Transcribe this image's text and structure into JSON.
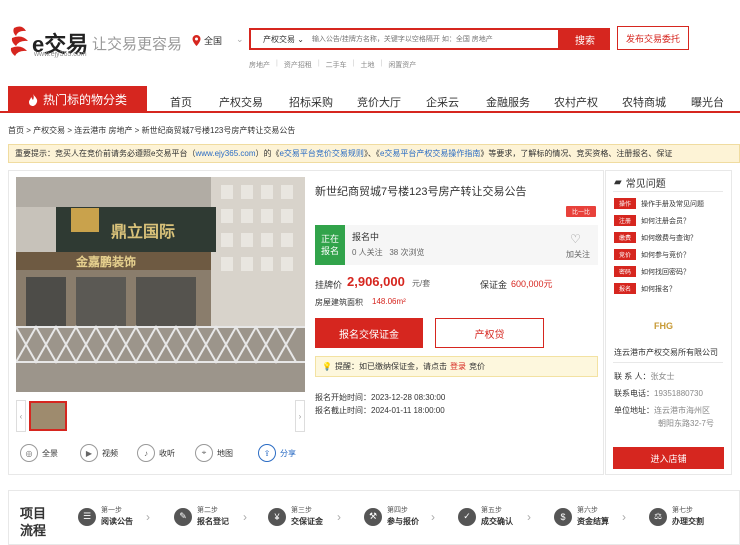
{
  "header": {
    "logo_text": "e交易",
    "logo_url": "www.ejy365.com",
    "slogan": "让交易更容易",
    "region": "全国",
    "search_category": "产权交易 ⌄",
    "search_placeholder": "输入公告/挂牌方名称，关键字以空格隔开 如：全国 房地产",
    "search_button": "搜索",
    "publish_button": "发布交易委托",
    "hot_words": [
      "房地产",
      "资产招租",
      "二手车",
      "土地",
      "闲置资产"
    ]
  },
  "nav": {
    "category_label": "热门标的物分类",
    "items": [
      "首页",
      "产权交易",
      "招标采购",
      "竞价大厅",
      "企采云",
      "金融服务",
      "农村产权",
      "农特商城",
      "曝光台"
    ]
  },
  "breadcrumb": "首页 > 产权交易 > 连云港市 房地产 > 新世纪商贸城7号楼123号房产转让交易公告",
  "notice": {
    "prefix": "重要提示：竞买人在竞价前请务必遵照e交易平台（",
    "site": "www.ejy365.com",
    "mid1": "）的《",
    "rule1": "e交易平台竞价交易规则",
    "mid2": "》、《",
    "rule2": "e交易平台产权交易操作指南",
    "suffix": "》等要求，了解标的情况、竞买资格、注册报名、保证"
  },
  "listing": {
    "title": "新世纪商贸城7号楼123号房产转让交易公告",
    "badge": "比一比",
    "status_tag_1": "正在",
    "status_tag_2": "报名",
    "status_text": "报名中",
    "followers": "0 人关注",
    "views": "38 次浏览",
    "follow_label": "加关注",
    "price_label": "挂牌价",
    "price_value": "2,906,000",
    "price_unit": "元/套",
    "deposit_label": "保证金",
    "deposit_value": "600,000元",
    "area_label": "房屋建筑面积",
    "area_value": "148.06m²",
    "deposit_button": "报名交保证金",
    "loan_button": "产权贷",
    "tip_prefix": "提醒：如已缴纳保证金，请点击",
    "tip_link": "登录",
    "tip_suffix": "竞价",
    "start_time": "报名开始时间：2023-12-28 08:30:00",
    "end_time": "报名截止时间：2024-01-11 18:00:00"
  },
  "tools": [
    "全景",
    "视频",
    "收听",
    "地图",
    "分享"
  ],
  "photo": {
    "sign_1": "鼎立国际",
    "sign_2": "金嘉鹏装饰"
  },
  "sidebar": {
    "faq_title": "常见问题",
    "faqs": [
      {
        "tag": "操作",
        "text": "操作手册及常见问题"
      },
      {
        "tag": "注册",
        "text": "如何注册会员？"
      },
      {
        "tag": "缴费",
        "text": "如何缴费与查询？"
      },
      {
        "tag": "竞价",
        "text": "如何参与竞价？"
      },
      {
        "tag": "密码",
        "text": "如何找回密码？"
      },
      {
        "tag": "报名",
        "text": "如何报名？"
      }
    ],
    "org_logo": "FHG",
    "company": "连云港市产权交易所有限公司",
    "contact_label": "联 系 人：",
    "contact_value": "张女士",
    "phone_label": "联系电话：",
    "phone_value": "19351880730",
    "addr_label": "单位地址：",
    "addr_value_1": "连云港市海州区",
    "addr_value_2": "朝阳东路32-7号",
    "shop_button": "进入店铺"
  },
  "flow": {
    "title_1": "项目",
    "title_2": "流程",
    "steps": [
      {
        "n": "第一步",
        "t": "阅读公告"
      },
      {
        "n": "第二步",
        "t": "报名登记"
      },
      {
        "n": "第三步",
        "t": "交保证金"
      },
      {
        "n": "第四步",
        "t": "参与报价"
      },
      {
        "n": "第五步",
        "t": "成交确认"
      },
      {
        "n": "第六步",
        "t": "资金结算"
      },
      {
        "n": "第七步",
        "t": "办理交割"
      }
    ]
  },
  "colors": {
    "brand": "#d6261f",
    "status_green": "#31a34a",
    "link": "#2b6cc4"
  }
}
